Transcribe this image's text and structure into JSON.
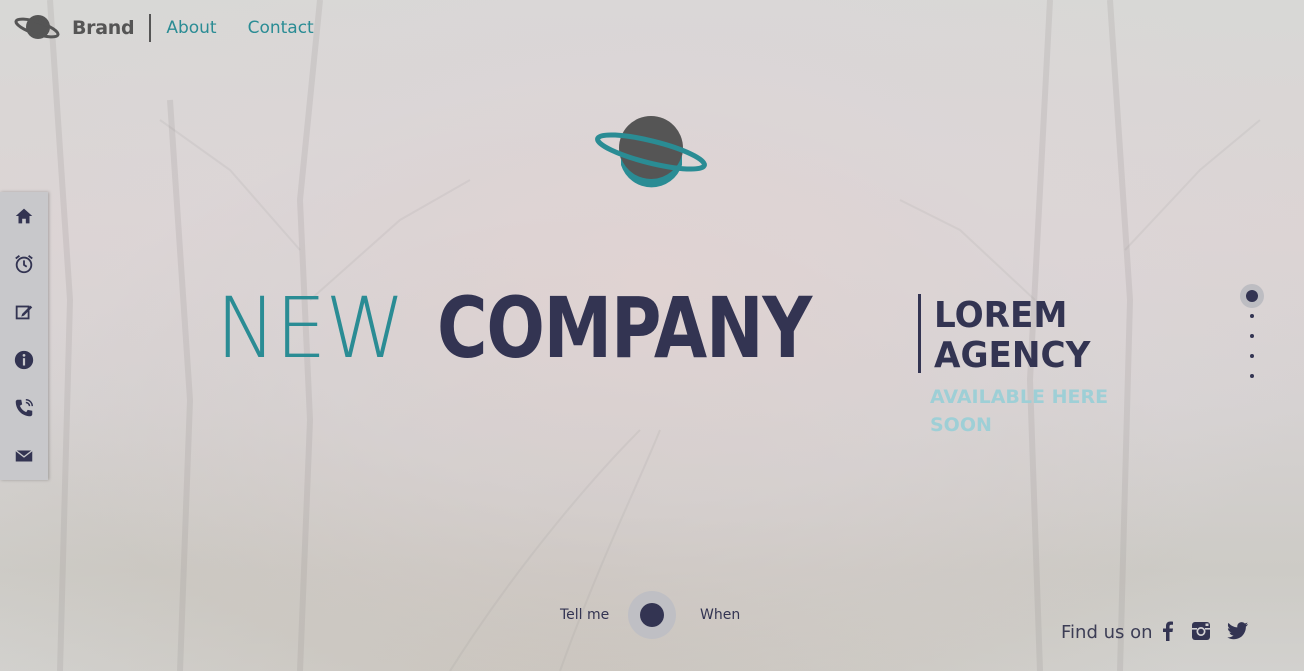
{
  "nav": {
    "brand": "Brand",
    "links": [
      "About",
      "Contact"
    ]
  },
  "hero": {
    "title_light": "NEW",
    "title_bold": "COMPANY",
    "subtitle_line1": "LOREM",
    "subtitle_line2": "AGENCY",
    "notice_line1": "AVAILABLE HERE",
    "notice_line2": "SOON"
  },
  "sidebar": {
    "icons": [
      "home-icon",
      "alarm-clock-icon",
      "edit-icon",
      "info-icon",
      "phone-icon",
      "envelope-icon"
    ]
  },
  "pager": {
    "count": 5,
    "active_index": 0
  },
  "toggle": {
    "left_label": "Tell me",
    "right_label": "When"
  },
  "footer": {
    "find_us": "Find us on",
    "socials": [
      "facebook-icon",
      "instagram-icon",
      "twitter-icon"
    ]
  },
  "colors": {
    "teal": "#2a8c94",
    "navy": "#333452",
    "light_teal": "#9ecfd6",
    "gray": "#555555"
  }
}
